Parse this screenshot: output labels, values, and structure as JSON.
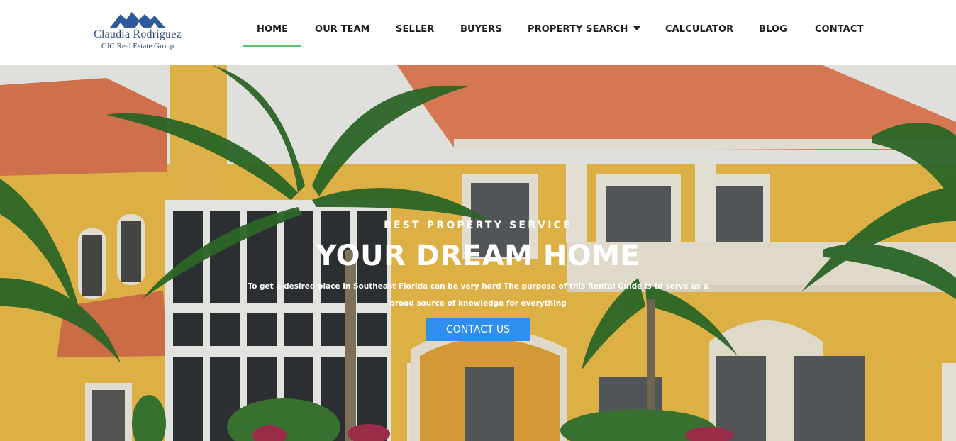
{
  "brand": {
    "name": "Claudia Rodriguez",
    "subtitle": "CJC Real Estate Group",
    "logo_icon": "house-roofs-icon",
    "color": "#2c4a78"
  },
  "nav": {
    "items": [
      {
        "label": "HOME",
        "active": true
      },
      {
        "label": "OUR TEAM"
      },
      {
        "label": "SELLER"
      },
      {
        "label": "BUYERS"
      },
      {
        "label": "PROPERTY SEARCH",
        "has_dropdown": true
      },
      {
        "label": "CALCULATOR"
      },
      {
        "label": "BLOG"
      },
      {
        "label": "CONTACT"
      }
    ],
    "active_color": "#5bc26b"
  },
  "hero": {
    "eyebrow": "BEST PROPERTY SERVICE",
    "headline": "YOUR DREAM HOME",
    "description": "To get a desired place in Southeast Florida can be very hard The purpose of this Rental Guide is to serve as a broad source of knowledge for everything",
    "cta_label": "CONTACT US",
    "cta_color": "#2e8ff0",
    "background": "yellow mediterranean house with terracotta tile roof and palm trees"
  }
}
